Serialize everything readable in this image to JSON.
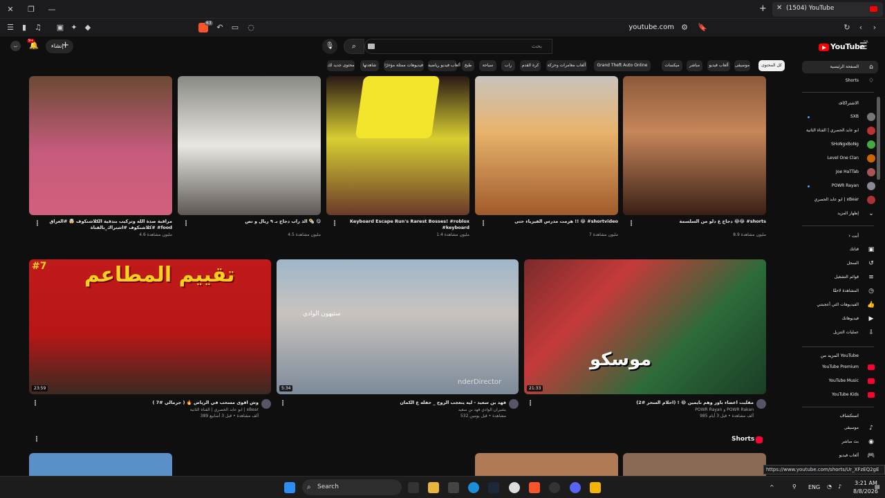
{
  "browser": {
    "tab_title": "(1504) YouTube",
    "url": "youtube.com",
    "shield_count": "63"
  },
  "header": {
    "logo_text": "YouTube",
    "logo_region": "SA",
    "search_placeholder": "بحث",
    "create_label": "إنشاء",
    "notif_count": "9+",
    "avatar_letter": "ب"
  },
  "chips": [
    {
      "label": "كل المحتوى",
      "active": true
    },
    {
      "label": "موسيقى"
    },
    {
      "label": "ألعاب فيديو"
    },
    {
      "label": "مباشر"
    },
    {
      "label": "ميكسات"
    },
    {
      "label": "Grand Theft Auto Online"
    },
    {
      "label": "ألعاب مغامرات وحركة"
    },
    {
      "label": "كرة القدم"
    },
    {
      "label": "راب"
    },
    {
      "label": "سياحة"
    },
    {
      "label": "طبخ"
    },
    {
      "label": "ألعاب فيديو رياضية"
    },
    {
      "label": "فيديوهات ممثلة مؤخرًا"
    },
    {
      "label": "شاهدتها"
    },
    {
      "label": "محتوى جديد لك"
    }
  ],
  "sidebar": {
    "home": "الصفحة الرئيسية",
    "shorts": "Shorts",
    "subscriptions_header": "الاشتراكات",
    "subscriptions": [
      {
        "name": "SXB",
        "dot": true
      },
      {
        "name": "ابو عابد الحصري | القناة الثانية",
        "dot": false
      },
      {
        "name": "SHoNgxBoNg",
        "dot": false
      },
      {
        "name": "Level One Clan",
        "dot": false
      },
      {
        "name": "Joe HaTTab",
        "dot": false
      },
      {
        "name": "POWR Rayan",
        "dot": true
      },
      {
        "name": "ابو عابد الحصري | xBear",
        "dot": false
      }
    ],
    "show_more": "إظهار المزيد",
    "you_header": "أنت",
    "you_items": [
      "قناتك",
      "السجل",
      "قوائم التشغيل",
      "المشاهدة لاحقًا",
      "الفيديوهات التي أعجبتني",
      "فيديوهاتك",
      "عمليات التنزيل"
    ],
    "more_header": "المزيد من YouTube",
    "more_items": [
      "YouTube Premium",
      "YouTube Music",
      "YouTube Kids"
    ],
    "explore_header": "استكشاف",
    "explore_items": [
      "موسيقى",
      "بث مباشر",
      "ألعاب فيديو"
    ]
  },
  "shorts_row": [
    {
      "title": "دجاج ع دلو من السلسمة 😂😂 #shorts",
      "views": "8.9 مليون مشاهدة"
    },
    {
      "title": "هزمت مدرس الفيزياء حتى !! 😂 #shortvideo",
      "views": "7 مليون مشاهدة"
    },
    {
      "title": "Keyboard Escape Run's Rarest Bosses! #roblox #keyboard",
      "views": "1.4 مليون مشاهدة"
    },
    {
      "title": "الذ راب دجاج بـ ٩ ريال و نص 🌯 😋",
      "views": "4.5 مليون مشاهدة"
    },
    {
      "title": "مراقبة صدة الله وتركيب بندقية الكلاشنكوف 🤯 #العراق #كلاشنكوف #اشتراك_بالقناة #food",
      "views": "4.6 مليون مشاهدة"
    }
  ],
  "videos_row": [
    {
      "title": "مقلبت اعضاء باور وهم نايمين 😂 ! (احلام السحر #2)",
      "channel": "POWR Rayan و POWR Rakan",
      "meta": "985 ألف مشاهدة • قبل 3 أيام",
      "duration": "21:33"
    },
    {
      "title": "فهد بن سعيد - ليه يتعجب الروح _ حفله ع الكمان",
      "channel": "بشيران الوادي فهد بن سعيد",
      "meta": "532 مشاهدة • قبل يومين",
      "duration": "5:34",
      "watermark": "ستيهون الوادي",
      "overlay_text": "nderDirector"
    },
    {
      "title": "وش اقوى مسحب في الرياض 🔥 ( جرمالي #7 )",
      "channel": "ابو عابد الحصري | القناة الثانية | xBear",
      "meta": "389 ألف مشاهدة • قبل 3 أسابيع",
      "duration": "23:59",
      "thumb_text": "تقييم المطاعم",
      "thumb_num": "#7"
    }
  ],
  "video1_thumb_text": "موسكو",
  "shorts_section_title": "Shorts",
  "status_url": "https://www.youtube.com/shorts/Ur_XFzEQ2gE",
  "taskbar": {
    "search": "Search",
    "lang": "ENG",
    "time": "3:21 AM",
    "date": "8/8/2026"
  },
  "colors": {
    "background": "#0f0f0f",
    "youtube_red": "#ff0000",
    "chip_bg": "#272727"
  }
}
